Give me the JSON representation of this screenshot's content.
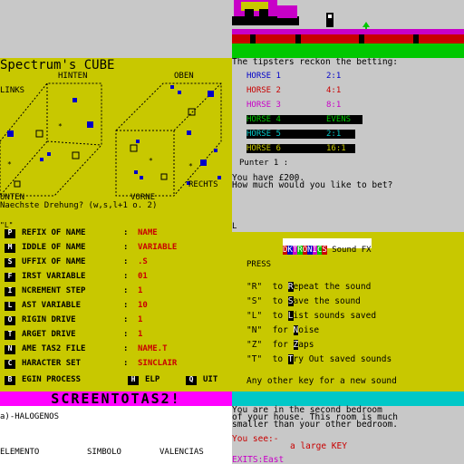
{
  "colors": {
    "yellow_bg": "#c8c800",
    "gray_bg": "#c8c8c8",
    "magenta": "#ff00ff",
    "cyan": "#00c8c8",
    "green": "#00c800",
    "red": "#c80000",
    "blue": "#0000c8",
    "white": "#ffffff",
    "black": "#000000"
  },
  "game_scene": {
    "description_icons": [
      "truck-icon",
      "player-sprite-icon",
      "plant-icon"
    ]
  },
  "cube_panel": {
    "title": "Spectrum's CUBE",
    "label_hinten": "HINTEN",
    "label_oben": "OBEN",
    "label_links": "LINKS",
    "label_unten": "UNTEN",
    "label_vorne": "VORNE",
    "label_rechts": "RECHTS",
    "prompt": "Naechste Drehung? (w,s,l+1 o. 2)"
  },
  "betting_panel": {
    "header": "The tipsters reckon the betting:",
    "horses": [
      {
        "name": "HORSE 1",
        "odds": "2:1",
        "color": "#0000c8"
      },
      {
        "name": "HORSE 2",
        "odds": "4:1",
        "color": "#c80000"
      },
      {
        "name": "HORSE 3",
        "odds": "8:1",
        "color": "#c800c8"
      },
      {
        "name": "HORSE 4",
        "odds": "EVENS",
        "color": "#00c800"
      },
      {
        "name": "HORSE 5",
        "odds": "2:1",
        "color": "#00c8c8"
      },
      {
        "name": "HORSE 6",
        "odds": "16:1",
        "color": "#c8c800"
      }
    ],
    "punter": "Punter 1 :",
    "money_line": "You have £200.",
    "question": "How much would you like to bet?",
    "cursor": "L"
  },
  "tas_panel": {
    "top_line": "\"L\"",
    "menu": [
      {
        "key": "P",
        "label": "REFIX OF NAME",
        "value": "NAME"
      },
      {
        "key": "M",
        "label": "IDDLE OF NAME",
        "value": "VARIABLE"
      },
      {
        "key": "S",
        "label": "UFFIX OF NAME",
        "value": ".S"
      },
      {
        "key": "F",
        "label": "IRST VARIABLE",
        "value": "01"
      },
      {
        "key": "I",
        "label": "NCREMENT STEP",
        "value": "1"
      },
      {
        "key": "L",
        "label": "AST VARIABLE",
        "value": "10"
      },
      {
        "key": "O",
        "label": "RIGIN DRIVE",
        "value": "1"
      },
      {
        "key": "T",
        "label": "ARGET DRIVE",
        "value": "1"
      },
      {
        "key": "N",
        "label": "AME TAS2 FILE",
        "value": "NAME.T"
      },
      {
        "key": "C",
        "label": "HARACTER SET",
        "value": "SINCLAIR"
      }
    ],
    "bottom": {
      "begin_key": "B",
      "begin_label": "EGIN PROCESS",
      "help_key": "H",
      "help_label": "ELP",
      "quit_key": "Q",
      "quit_label": "UIT"
    },
    "banner": "SCREENTOTAS2!"
  },
  "sound_panel": {
    "title_brand": "DKTRONICS",
    "title_rest": " Sound FX",
    "press": "PRESS",
    "options": [
      {
        "key": "\"R\"",
        "pre": "to ",
        "hot": "R",
        "post": "epeat the sound"
      },
      {
        "key": "\"S\"",
        "pre": "to ",
        "hot": "S",
        "post": "ave the sound"
      },
      {
        "key": "\"L\"",
        "pre": "to ",
        "hot": "L",
        "post": "ist sounds saved"
      },
      {
        "key": "\"N\"",
        "pre": "for ",
        "hot": "N",
        "post": "oise"
      },
      {
        "key": "\"Z\"",
        "pre": "for ",
        "hot": "Z",
        "post": "aps"
      },
      {
        "key": "\"T\"",
        "pre": "to ",
        "hot": "T",
        "post": "ry Out saved sounds"
      }
    ],
    "any_key": "Any other key for a new sound"
  },
  "chem_panel": {
    "line1": "a)-HALOGENOS",
    "col1": "ELEMENTO",
    "col2": "SIMBOLO",
    "col3": "VALENCIAS"
  },
  "adventure_panel": {
    "line1": "You are in the second bedroom",
    "line2": "of your house. This room is much",
    "line3": "smaller than your other bedroom.",
    "see": "You see:-",
    "item": "a large KEY",
    "exits": "EXITS:East"
  }
}
